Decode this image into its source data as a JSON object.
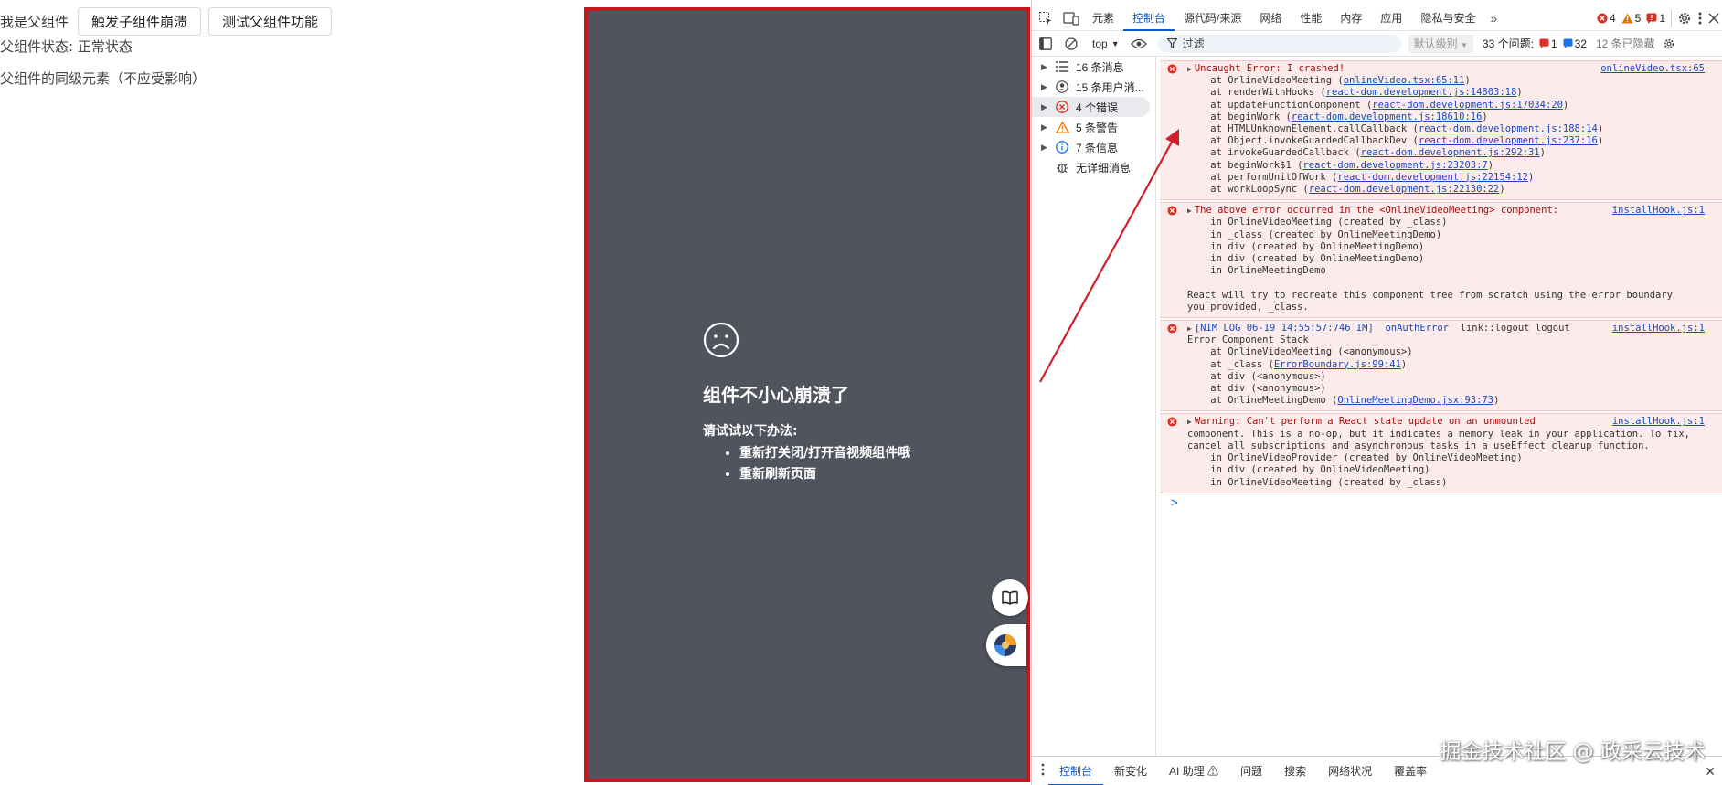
{
  "page": {
    "parent_label": "我是父组件",
    "buttons": {
      "crash_child": "触发子组件崩溃",
      "test_parent": "测试父组件功能"
    },
    "status_text": "父组件状态: 正常状态",
    "sibling_text": "父组件的同级元素（不应受影响）"
  },
  "crash_panel": {
    "title": "组件不小心崩溃了",
    "hint": "请试试以下办法:",
    "suggestions": [
      "重新打关闭/打开音视频组件哦",
      "重新刷新页面"
    ]
  },
  "devtools": {
    "tabs": [
      "元素",
      "控制台",
      "源代码/来源",
      "网络",
      "性能",
      "内存",
      "应用",
      "隐私与安全"
    ],
    "active_tab": "控制台",
    "more_tabs": "»",
    "counts": {
      "errors": "4",
      "warnings": "5",
      "issues": "1"
    },
    "toolbar": {
      "context": "top",
      "filter_placeholder": "过滤",
      "level": "默认级别",
      "issues_label": "33 个问题:",
      "issues_err": "1",
      "issues_info": "32",
      "hidden": "12 条已隐藏"
    },
    "sidebar": [
      {
        "label": "16 条消息",
        "icon": "list-icon"
      },
      {
        "label": "15 条用户消...",
        "icon": "user-icon"
      },
      {
        "label": "4 个错误",
        "icon": "error-icon"
      },
      {
        "label": "5 条警告",
        "icon": "warning-icon"
      },
      {
        "label": "7 条信息",
        "icon": "info-icon"
      },
      {
        "label": "无详细消息",
        "icon": "bug-icon"
      }
    ],
    "messages": [
      {
        "source": "onlineVideo.tsx:65",
        "head": "Uncaught Error: I crashed!",
        "lines": [
          [
            "    at OnlineVideoMeeting (",
            "onlineVideo.tsx:65:11",
            ")"
          ],
          [
            "    at renderWithHooks (",
            "react-dom.development.js:14803:18",
            ")"
          ],
          [
            "    at updateFunctionComponent (",
            "react-dom.development.js:17034:20",
            ")"
          ],
          [
            "    at beginWork (",
            "react-dom.development.js:18610:16",
            ")"
          ],
          [
            "    at HTMLUnknownElement.callCallback (",
            "react-dom.development.js:188:14",
            ")"
          ],
          [
            "    at Object.invokeGuardedCallbackDev (",
            "react-dom.development.js:237:16",
            ")"
          ],
          [
            "    at invokeGuardedCallback (",
            "react-dom.development.js:292:31",
            ")"
          ],
          [
            "    at beginWork$1 (",
            "react-dom.development.js:23203:7",
            ")"
          ],
          [
            "    at performUnitOfWork (",
            "react-dom.development.js:22154:12",
            ")"
          ],
          [
            "    at workLoopSync (",
            "react-dom.development.js:22130:22",
            ")"
          ]
        ]
      },
      {
        "source": "installHook.js:1",
        "head": "The above error occurred in the <OnlineVideoMeeting> component:",
        "lines": [
          "    in OnlineVideoMeeting (created by _class)",
          "    in _class (created by OnlineMeetingDemo)",
          "    in div (created by OnlineMeetingDemo)",
          "    in div (created by OnlineMeetingDemo)",
          "    in OnlineMeetingDemo",
          "",
          "React will try to recreate this component tree from scratch using the error boundary",
          "you provided, _class."
        ]
      },
      {
        "source": "installHook.js:1",
        "head_blue": "[NIM LOG 06-19 14:55:57:746 IM]  onAuthError",
        "head_rest": "  link::logout logout",
        "lines": [
          [
            "Error Component Stack",
            "",
            ""
          ],
          [
            "    at OnlineVideoMeeting (<anonymous>)",
            "",
            ""
          ],
          [
            "    at _class (",
            "ErrorBoundary.js:99:41",
            ")"
          ],
          [
            "    at div (<anonymous>)",
            "",
            ""
          ],
          [
            "    at div (<anonymous>)",
            "",
            ""
          ],
          [
            "    at OnlineMeetingDemo (",
            "OnlineMeetingDemo.jsx:93:73",
            ")"
          ]
        ]
      },
      {
        "source": "installHook.js:1",
        "head": "Warning: Can't perform a React state update on an unmounted",
        "lines": [
          "component. This is a no-op, but it indicates a memory leak in your application. To fix,",
          "cancel all subscriptions and asynchronous tasks in a useEffect cleanup function.",
          "    in OnlineVideoProvider (created by OnlineVideoMeeting)",
          "    in div (created by OnlineVideoMeeting)",
          "    in OnlineVideoMeeting (created by _class)"
        ]
      }
    ],
    "prompt": ">",
    "drawer_tabs": [
      "控制台",
      "新变化",
      "AI 助理 ⚠",
      "问题",
      "搜索",
      "网络状况",
      "覆盖率"
    ],
    "drawer_close": "✕"
  },
  "watermark": "掘金技术社区 @ 政采云技术",
  "colors": {
    "accent": "#0b57d0",
    "error_bg": "#fcebeb",
    "error_text": "#a50e0e",
    "panel_bg": "#51545e",
    "panel_border": "#c8161d",
    "arrow": "#d0202a"
  }
}
